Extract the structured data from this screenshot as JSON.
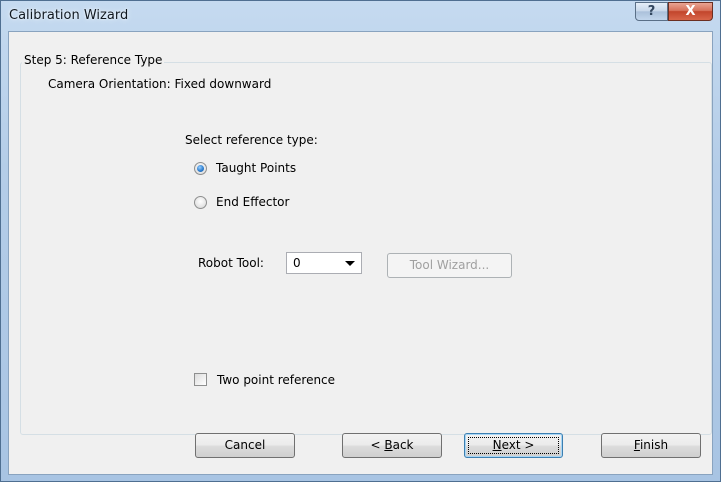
{
  "window": {
    "title": "Calibration Wizard",
    "help_glyph": "?",
    "close_glyph": "X"
  },
  "step": {
    "title": "Step 5: Reference Type",
    "camera_orientation": "Camera Orientation: Fixed downward"
  },
  "reference": {
    "prompt": "Select reference type:",
    "options": [
      {
        "label": "Taught Points",
        "selected": true
      },
      {
        "label": "End Effector",
        "selected": false
      }
    ]
  },
  "robot_tool": {
    "label": "Robot Tool:",
    "value": "0",
    "tool_wizard_label": "Tool Wizard..."
  },
  "two_point": {
    "label": "Two point reference",
    "checked": false
  },
  "buttons": {
    "cancel": "Cancel",
    "back_prefix": "< ",
    "back_mnemonic": "B",
    "back_rest": "ack",
    "next_mnemonic": "N",
    "next_rest": "ext >",
    "finish_mnemonic": "F",
    "finish_rest": "inish"
  }
}
